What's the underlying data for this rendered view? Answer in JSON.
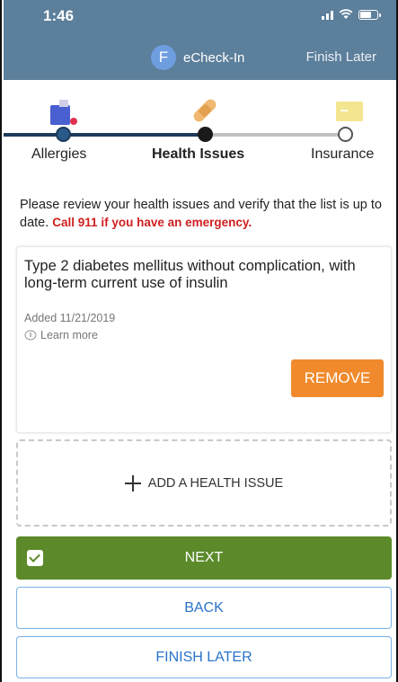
{
  "status_bar": {
    "time": "1:46"
  },
  "header": {
    "avatar_letter": "F",
    "title": "eCheck-In",
    "finish_later": "Finish Later"
  },
  "stepper": {
    "steps": [
      {
        "label": "Allergies",
        "icon": "allergy-bottle-icon",
        "state": "complete"
      },
      {
        "label": "Health Issues",
        "icon": "bandage-icon",
        "state": "current"
      },
      {
        "label": "Insurance",
        "icon": "insurance-card-icon",
        "state": "upcoming"
      }
    ],
    "colors": {
      "complete": "#1e3a5c",
      "current": "#1a1a1a",
      "upcoming": "#bbbbbb"
    }
  },
  "intro": {
    "text": "Please review your health issues and verify that the list is up to date.",
    "warning": "Call 911 if you have an emergency."
  },
  "issue": {
    "title": "Type 2 diabetes mellitus without complication, with long-term current use of insulin",
    "added": "Added 11/21/2019",
    "learn_more": "Learn more",
    "remove_label": "REMOVE"
  },
  "add_issue_label": "ADD A HEALTH ISSUE",
  "buttons": {
    "next": "NEXT",
    "back": "BACK",
    "finish_later": "FINISH LATER"
  },
  "colors": {
    "header_bg": "#5c7f9b",
    "next_bg": "#5c8a2a",
    "remove_bg": "#f08a2c",
    "warning": "#d02020",
    "link_blue": "#2a73c9"
  }
}
